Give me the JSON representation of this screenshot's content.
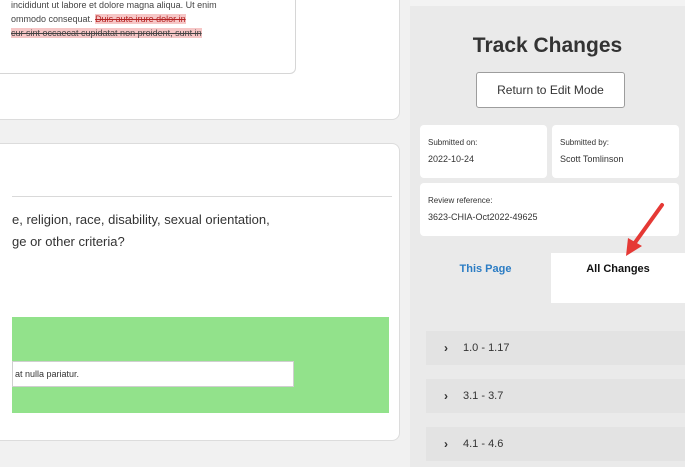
{
  "document": {
    "snippet_line1": "incididunt ut labore et dolore magna aliqua. Ut enim",
    "snippet_line2_normal": "ommodo consequat. ",
    "snippet_line2_deleted": "Duis aute irure dolor in",
    "snippet_line3_deleted": "cur sint occaecat cupidatat non proident, sunt in",
    "question_line1": "e, religion, race, disability, sexual orientation,",
    "question_line2": "ge or other criteria?",
    "answer_text": "at nulla pariatur."
  },
  "track_changes": {
    "title": "Track Changes",
    "return_button": "Return to Edit Mode",
    "submitted_on_label": "Submitted on:",
    "submitted_on_value": "2022-10-24",
    "submitted_by_label": "Submitted by:",
    "submitted_by_value": "Scott Tomlinson",
    "review_ref_label": "Review reference:",
    "review_ref_value": "3623-CHIA-Oct2022-49625",
    "tabs": {
      "this_page": "This Page",
      "all_changes": "All Changes"
    },
    "sections": [
      "1.0 - 1.17",
      "3.1 - 3.7",
      "4.1 - 4.6"
    ]
  },
  "colors": {
    "accent_blue": "#2b7cc4",
    "highlight_green": "#92e28b",
    "annotation_arrow": "#e53935"
  }
}
